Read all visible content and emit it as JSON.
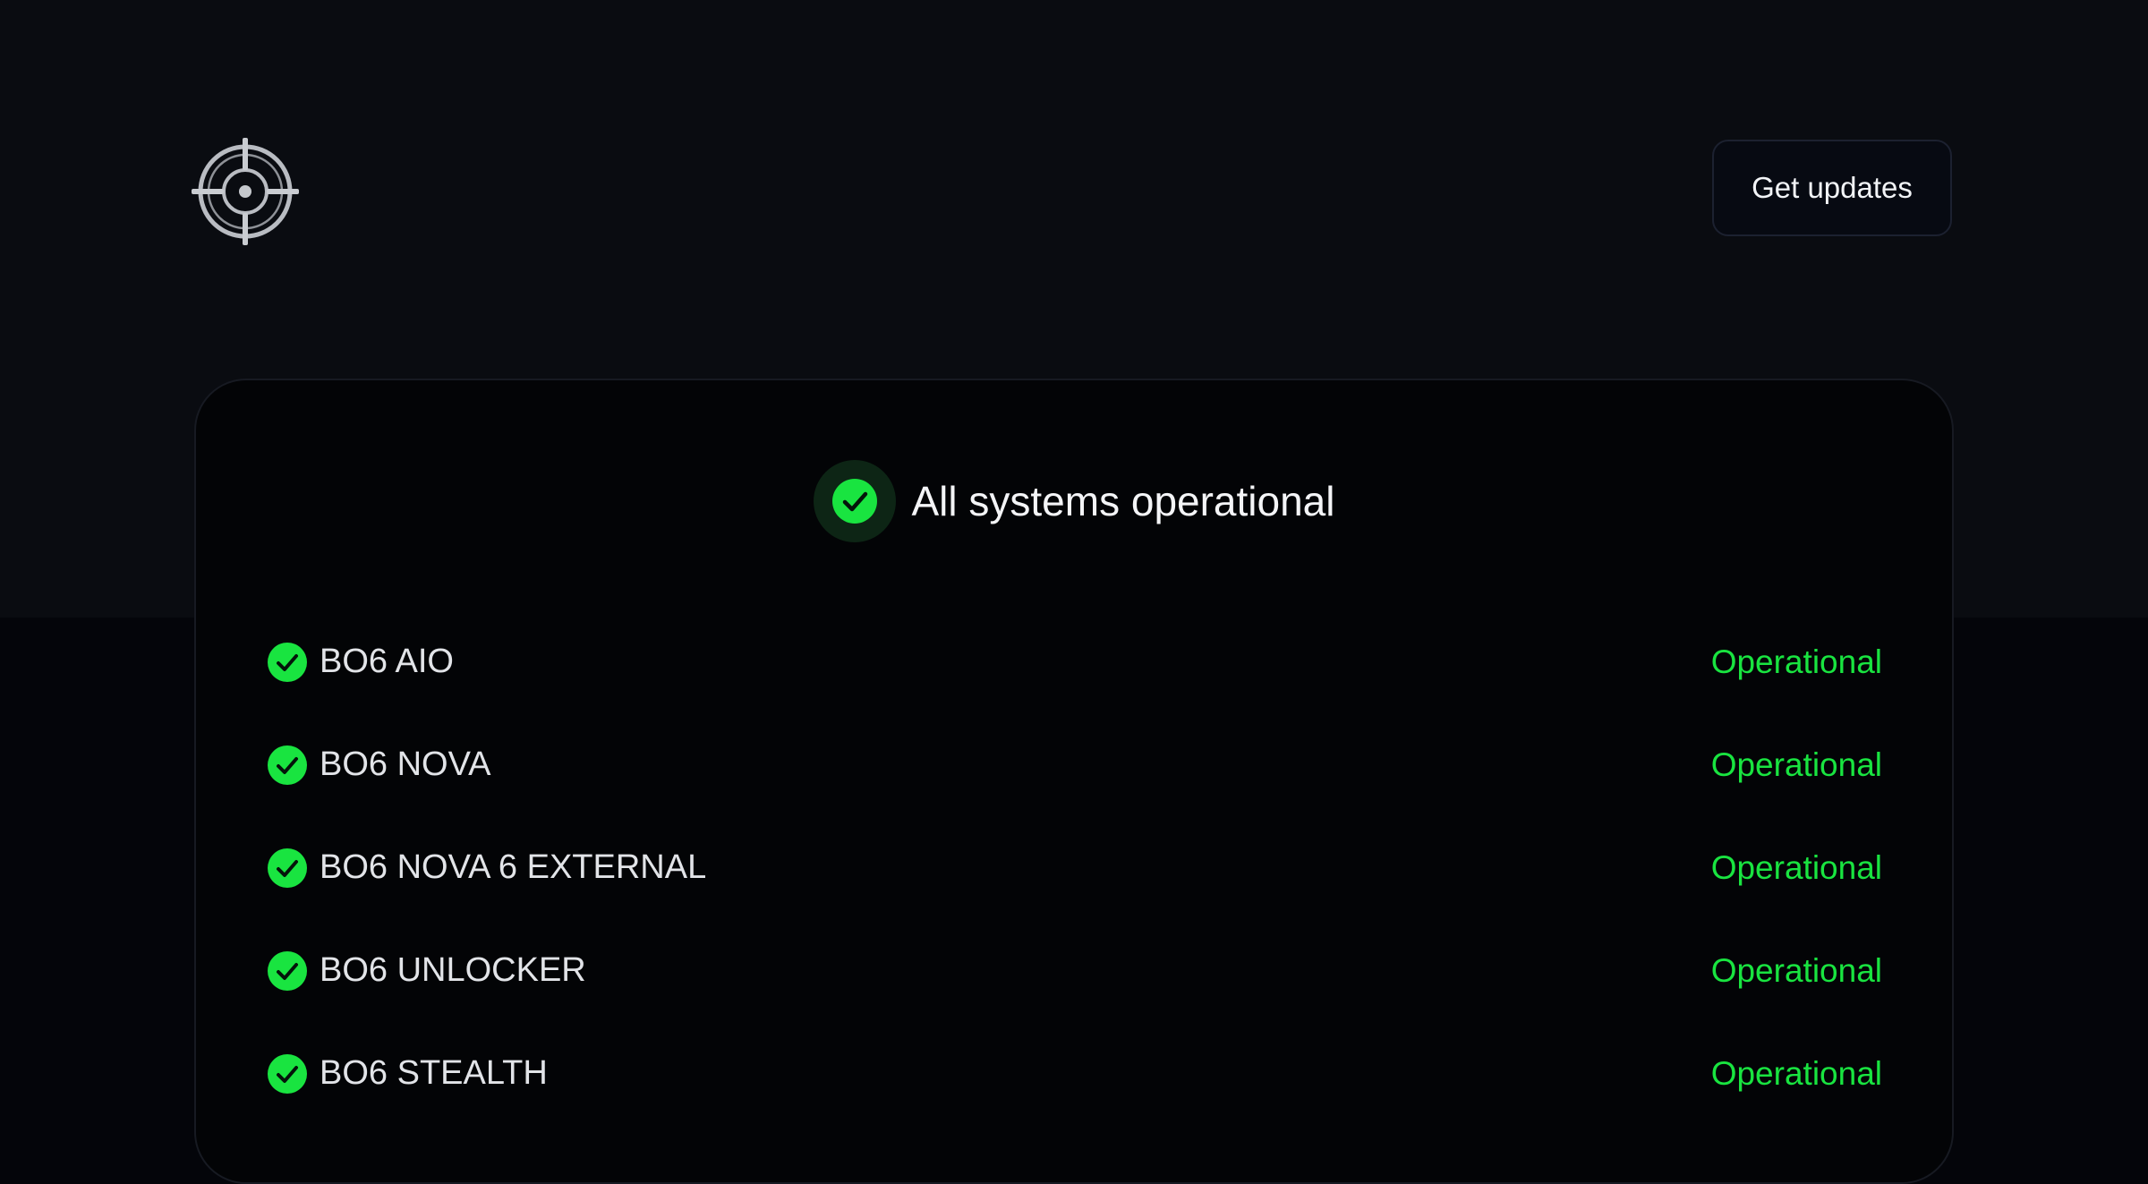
{
  "header": {
    "logo_icon": "crosshair-logo-icon",
    "updates_label": "Get updates"
  },
  "summary": {
    "icon": "check-circle-icon",
    "text": "All systems operational",
    "accent_color": "#19e440"
  },
  "services": [
    {
      "name": "BO6 AIO",
      "status": "Operational",
      "icon": "check-circle-icon"
    },
    {
      "name": "BO6 NOVA",
      "status": "Operational",
      "icon": "check-circle-icon"
    },
    {
      "name": "BO6 NOVA 6 EXTERNAL",
      "status": "Operational",
      "icon": "check-circle-icon"
    },
    {
      "name": "BO6 UNLOCKER",
      "status": "Operational",
      "icon": "check-circle-icon"
    },
    {
      "name": "BO6 STEALTH",
      "status": "Operational",
      "icon": "check-circle-icon"
    }
  ],
  "colors": {
    "background_top": "#0a0c11",
    "background_bottom": "#04050a",
    "card": "#030406",
    "operational": "#19e440"
  }
}
